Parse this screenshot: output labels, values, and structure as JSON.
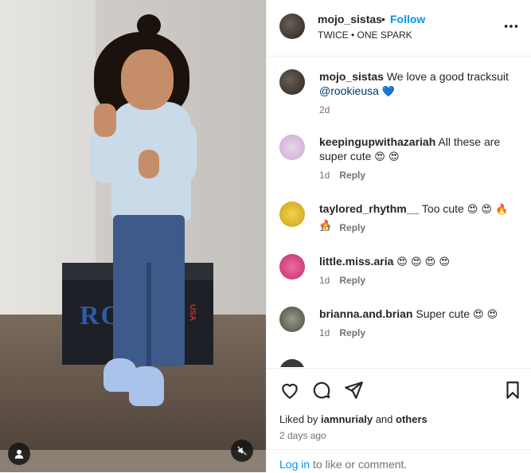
{
  "header": {
    "username": "mojo_sistas",
    "separator": "•",
    "follow_label": "Follow",
    "audio": "TWICE • ONE SPARK"
  },
  "media": {
    "box_text": "RO    E",
    "box_sub": "USA"
  },
  "comments": [
    {
      "user": "mojo_sistas",
      "text": "We love a good tracksuit",
      "mention": "@rookieusa",
      "emoji": "💙",
      "time": "2d",
      "reply": ""
    },
    {
      "user": "keepingupwithazariah",
      "text": "All these are super cute",
      "mention": "",
      "emoji": "😍 😍",
      "time": "1d",
      "reply": "Reply"
    },
    {
      "user": "taylored_rhythm__",
      "text": "Too cute",
      "mention": "",
      "emoji": "😍 😍 🔥 🔥",
      "time": "1d",
      "reply": "Reply"
    },
    {
      "user": "little.miss.aria",
      "text": "",
      "mention": "",
      "emoji": "😍 😍 😍 😍",
      "time": "1d",
      "reply": "Reply"
    },
    {
      "user": "brianna.and.brian",
      "text": "Super cute",
      "mention": "",
      "emoji": "😍 😍",
      "time": "1d",
      "reply": "Reply"
    }
  ],
  "footer": {
    "liked_prefix": "Liked by",
    "liked_user": "iamnurialy",
    "liked_and": "and",
    "liked_others": "others",
    "date": "2 days ago",
    "login_link": "Log in",
    "login_text": "to like or comment."
  },
  "colors": {
    "link": "#0095f6",
    "heart": "#1877d2"
  }
}
